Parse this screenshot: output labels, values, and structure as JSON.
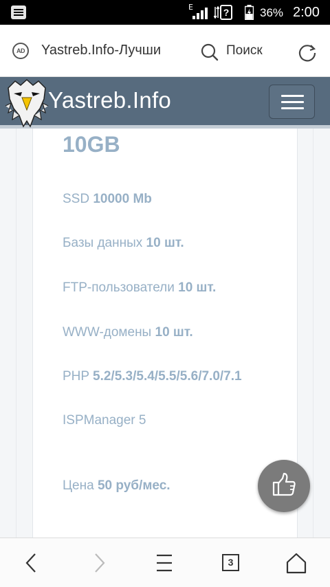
{
  "status_bar": {
    "network_type": "E",
    "battery_percent": "36%",
    "time": "2:00"
  },
  "browser": {
    "page_title": "Yastreb.Info-Лучши",
    "search_label": "Поиск",
    "ad_icon_label": "AD",
    "tab_count": "3"
  },
  "site": {
    "name": "Yastreb.Info"
  },
  "plan": {
    "size": "10GB",
    "features": [
      {
        "label": "SSD",
        "value": "10000 Mb"
      },
      {
        "label": "Базы данных",
        "value": "10 шт."
      },
      {
        "label": "FTP-пользователи",
        "value": "10 шт."
      },
      {
        "label": "WWW-домены",
        "value": "10 шт."
      },
      {
        "label": "PHP",
        "value": "5.2/5.3/5.4/5.5/5.6/7.0/7.1"
      },
      {
        "label": "ISPManager 5",
        "value": ""
      }
    ],
    "price_label": "Цена",
    "price_value": "50 руб/мес."
  },
  "colors": {
    "header_bg": "#576b7e",
    "text_accent": "#97b0c6",
    "like_button_bg": "#7b7b7b"
  }
}
